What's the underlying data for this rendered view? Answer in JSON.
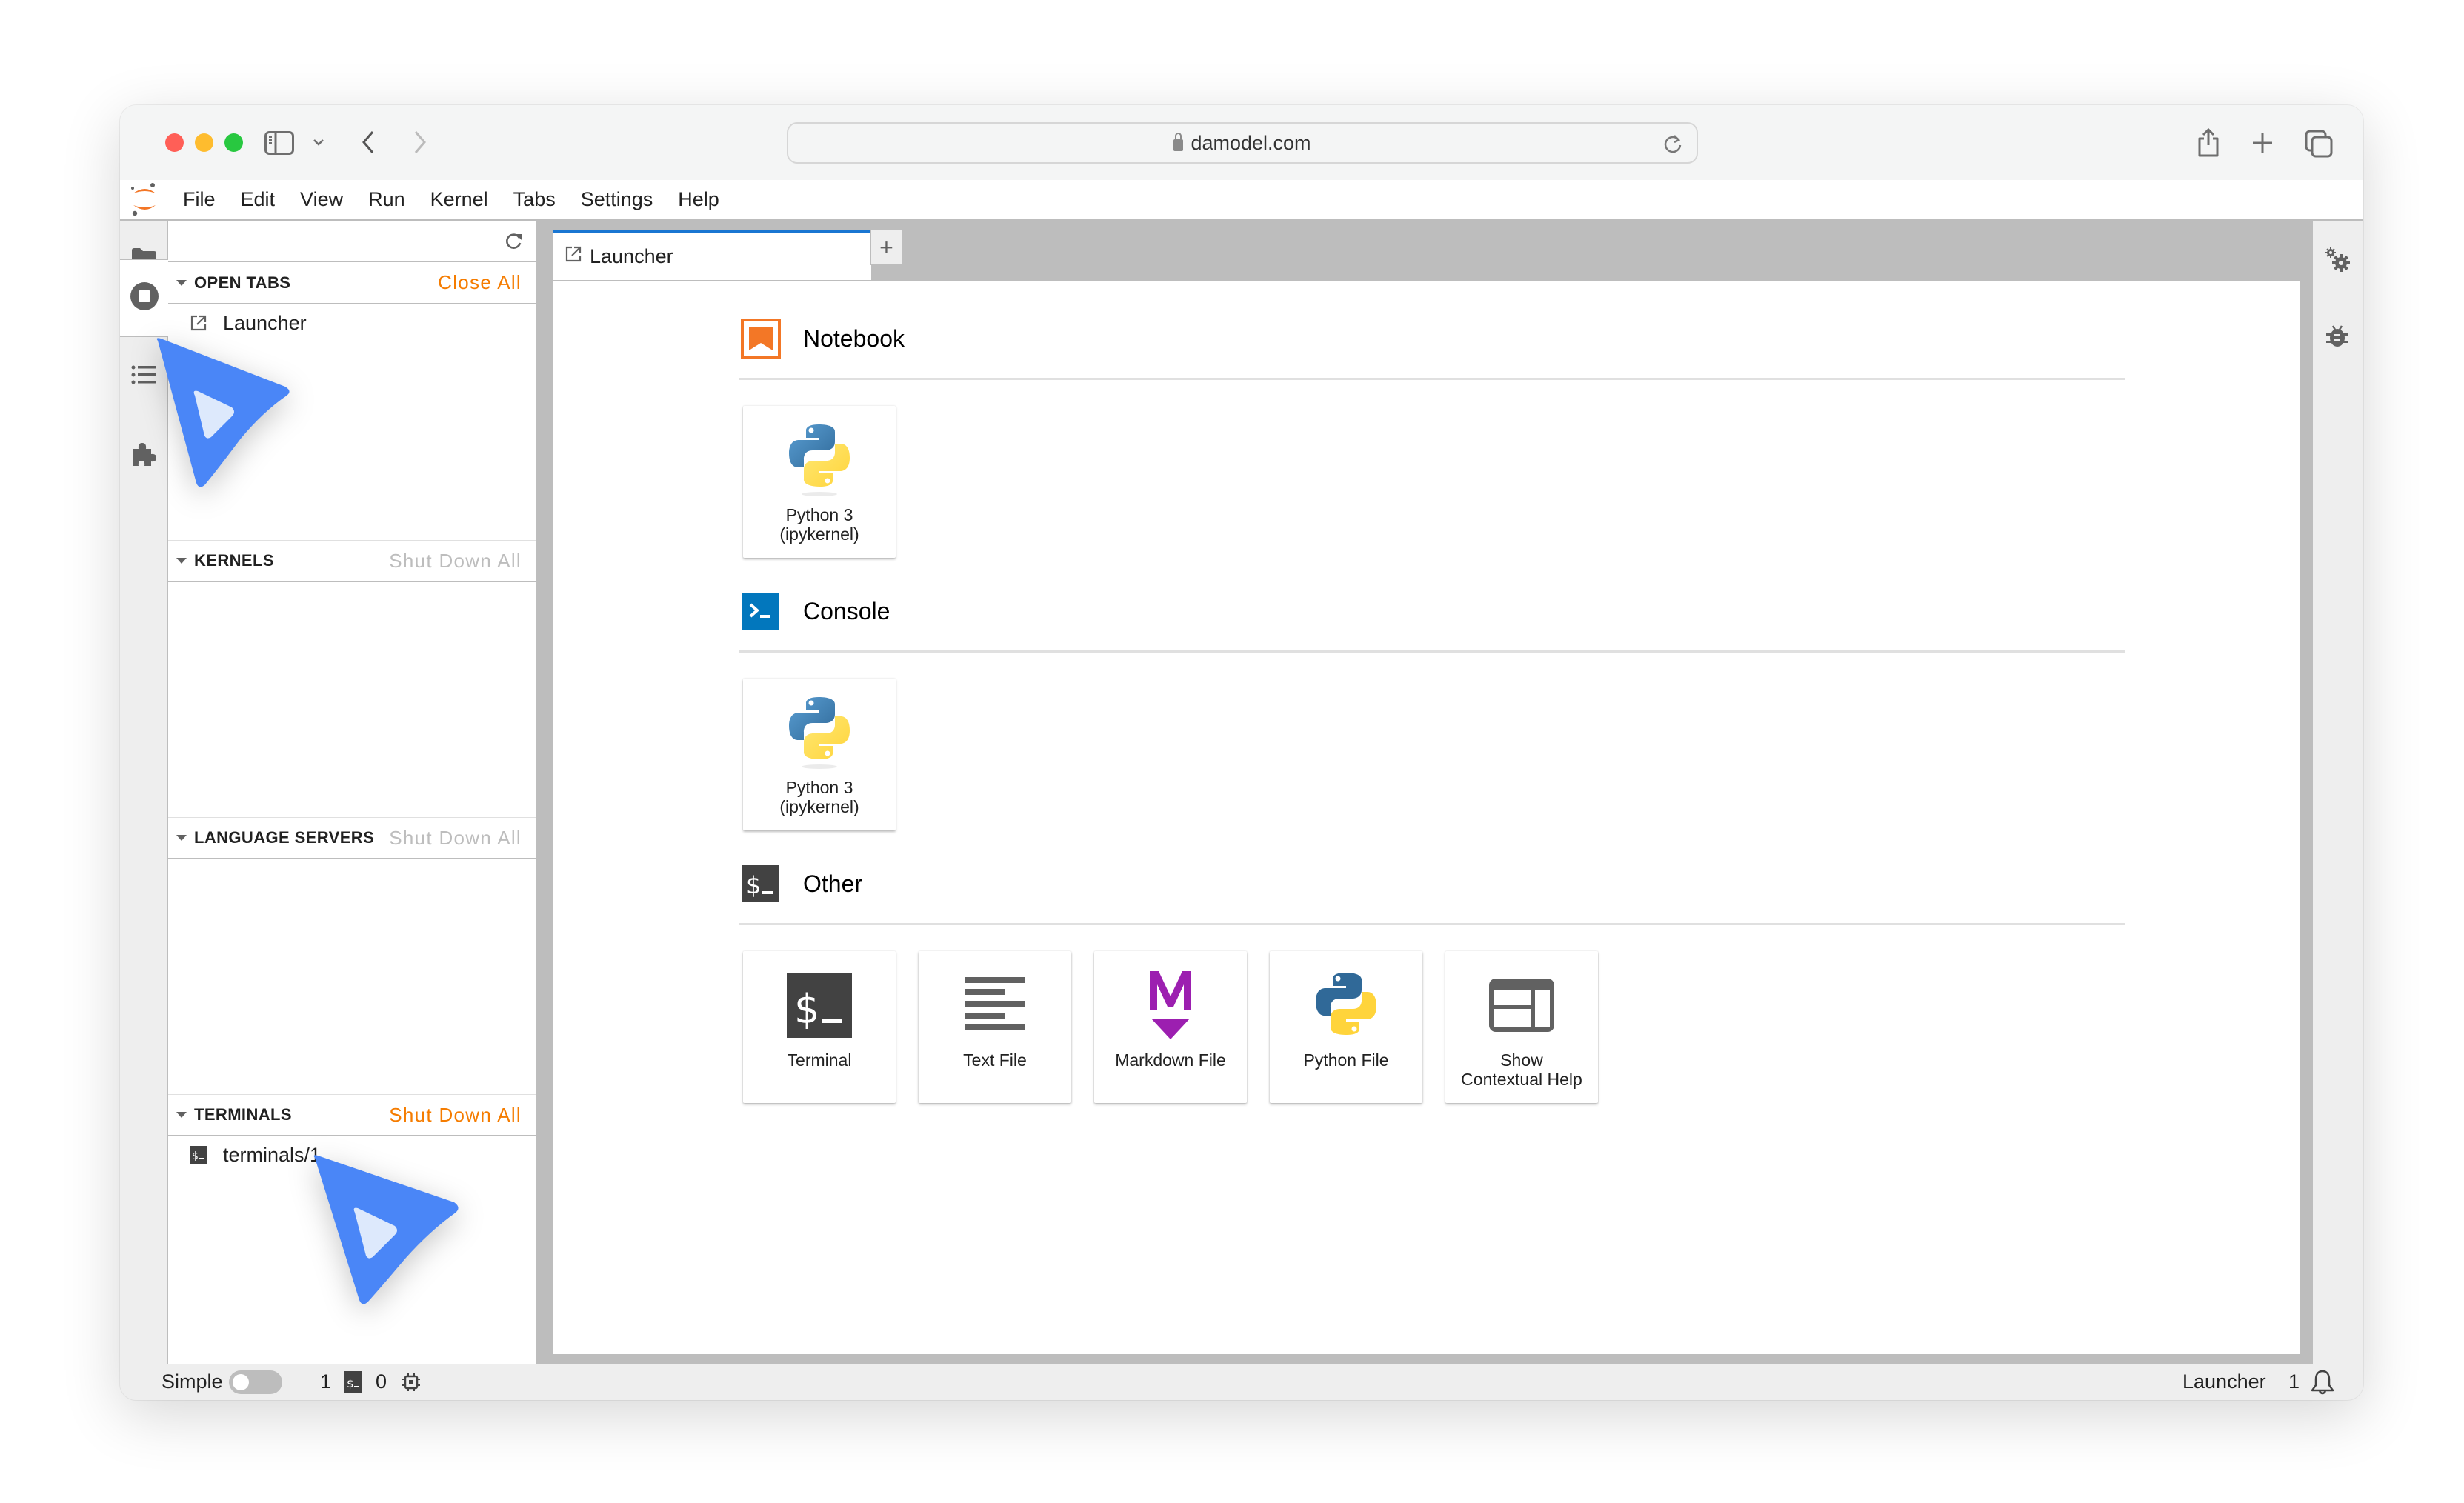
{
  "browser": {
    "url": "damodel.com",
    "traffic_lights": {
      "close": "#ff5f57",
      "minimize": "#febc2e",
      "maximize": "#28c840"
    },
    "toolbar_icons": [
      "sidebar-toggle-icon",
      "chevron-down-icon",
      "back-icon",
      "forward-icon",
      "share-icon",
      "new-tab-icon",
      "tab-overview-icon"
    ]
  },
  "menu": {
    "items": [
      "File",
      "Edit",
      "View",
      "Run",
      "Kernel",
      "Tabs",
      "Settings",
      "Help"
    ]
  },
  "left_rail": {
    "items": [
      {
        "icon": "folder-icon",
        "active": false
      },
      {
        "icon": "running-sessions-icon",
        "active": true
      },
      {
        "icon": "table-of-contents-icon",
        "active": false
      },
      {
        "icon": "extension-icon",
        "active": false
      }
    ]
  },
  "running_panel": {
    "refresh_icon": "refresh-icon",
    "sections": [
      {
        "title": "OPEN TABS",
        "action": "Close All",
        "action_enabled": true,
        "items": [
          {
            "icon": "launcher-icon",
            "label": "Launcher"
          }
        ]
      },
      {
        "title": "KERNELS",
        "action": "Shut Down All",
        "action_enabled": false,
        "items": []
      },
      {
        "title": "LANGUAGE SERVERS",
        "action": "Shut Down All",
        "action_enabled": false,
        "items": []
      },
      {
        "title": "TERMINALS",
        "action": "Shut Down All",
        "action_enabled": true,
        "items": [
          {
            "icon": "terminal-icon",
            "label": "terminals/1"
          }
        ]
      }
    ]
  },
  "tabs": {
    "items": [
      {
        "label": "Launcher",
        "active": true,
        "icon": "launcher-icon"
      }
    ],
    "add_label": "+"
  },
  "launcher": {
    "sections": [
      {
        "title": "Notebook",
        "icon": "notebook-icon",
        "cards": [
          {
            "label": "Python 3\n(ipykernel)",
            "icon": "python-icon"
          }
        ]
      },
      {
        "title": "Console",
        "icon": "console-icon",
        "cards": [
          {
            "label": "Python 3\n(ipykernel)",
            "icon": "python-icon"
          }
        ]
      },
      {
        "title": "Other",
        "icon": "terminal-icon",
        "cards": [
          {
            "label": "Terminal",
            "icon": "terminal-icon"
          },
          {
            "label": "Text File",
            "icon": "text-file-icon"
          },
          {
            "label": "Markdown File",
            "icon": "markdown-icon"
          },
          {
            "label": "Python File",
            "icon": "python-icon"
          },
          {
            "label": "Show\nContextual Help",
            "icon": "contextual-help-icon"
          }
        ]
      }
    ]
  },
  "right_rail": {
    "items": [
      {
        "icon": "property-inspector-icon"
      },
      {
        "icon": "debugger-icon"
      }
    ]
  },
  "statusbar": {
    "simple_label": "Simple",
    "simple_mode_on": false,
    "terminal_count": "1",
    "kernel_count": "0",
    "active_tab": "Launcher",
    "notification_count": "1"
  },
  "colors": {
    "accent_orange": "#f57c00",
    "tab_active_blue": "#1976d2",
    "console_blue": "#0277bd",
    "markdown_purple": "#7b1fa2",
    "cursor_blue": "#4a86f7"
  }
}
